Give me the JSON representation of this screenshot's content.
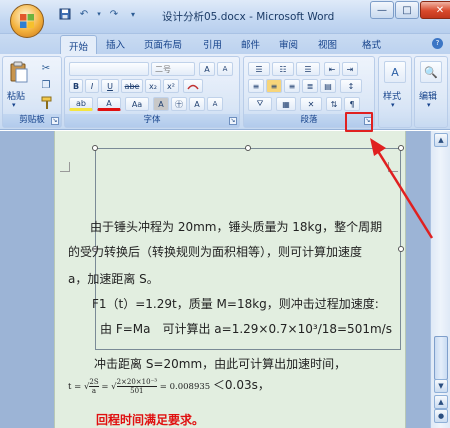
{
  "window": {
    "title": "设计分析05.docx - Microsoft Word",
    "min_label": "—",
    "max_label": "□",
    "close_label": "✕"
  },
  "tabs": [
    {
      "label": "开始",
      "active": true
    },
    {
      "label": "插入"
    },
    {
      "label": "页面布局"
    },
    {
      "label": "引用"
    },
    {
      "label": "邮件"
    },
    {
      "label": "审阅"
    },
    {
      "label": "视图"
    },
    {
      "label": "格式"
    }
  ],
  "ribbon": {
    "clipboard": {
      "label": "剪贴板",
      "paste_label": "粘贴"
    },
    "font": {
      "label": "字体",
      "size_value": "二号",
      "bold": "B",
      "italic": "I",
      "underline": "U",
      "strike": "abe",
      "subscript": "x₂",
      "superscript": "x²",
      "aa": "Aa",
      "grow": "A",
      "shrink": "A",
      "font_color": "A",
      "highlight": "ab",
      "charborder": "A",
      "enclose": "㊉"
    },
    "paragraph": {
      "label": "段落"
    },
    "styles": {
      "label": "样式"
    },
    "editing": {
      "label": "编辑"
    }
  },
  "document": {
    "line1": "由于锤头冲程为 20mm，锤头质量为 18kg，整个周期",
    "line2": "的受力转换后（转换规则为面积相等），则可计算加速度",
    "line3": "a，加速距离 S。",
    "line4": "F1（t）=1.29t，质量 M=18kg，则冲击过程加速度:",
    "line5": "由 F=Ma　可计算出 a=1.29×0.7×10³/18=501m/s",
    "line6": "冲击距离 S=20mm，由此可计算出加速时间，",
    "formula": {
      "lhs": "t =",
      "frac1_num": "2S",
      "frac1_den": "a",
      "eq": "=",
      "frac2_num": "2×20×10⁻³",
      "frac2_den": "501",
      "result": "= 0.008935",
      "compare": "＜0.03s，"
    },
    "line8": "回程时间满足要求。"
  },
  "colors": {
    "annotation": "#e02020",
    "page_bg": "#e2eee0"
  }
}
